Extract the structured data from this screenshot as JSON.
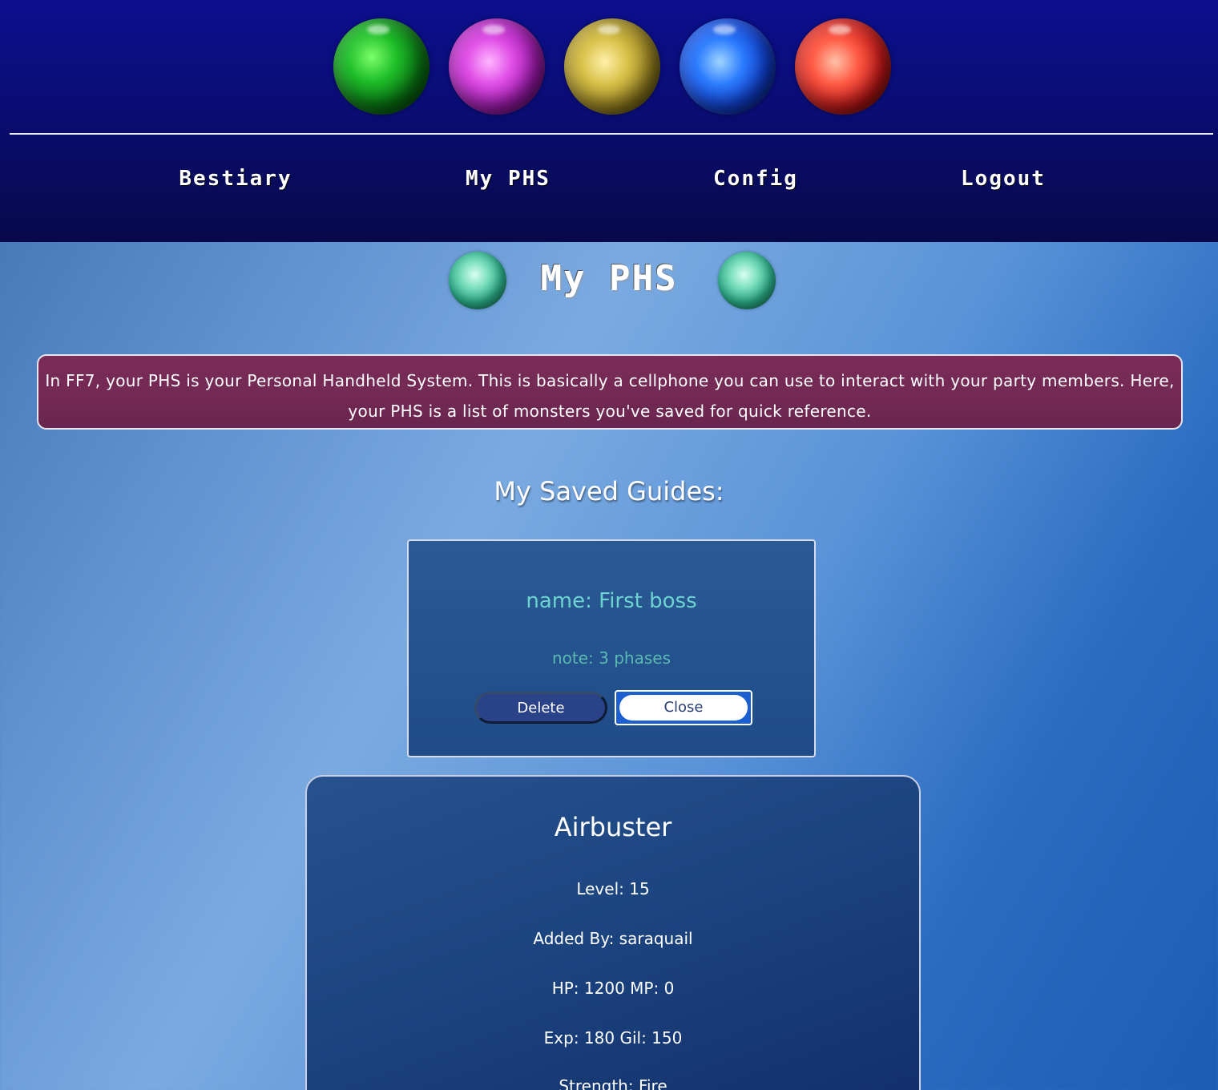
{
  "header": {
    "orbs": [
      "green-materia-icon",
      "purple-materia-icon",
      "yellow-materia-icon",
      "blue-materia-icon",
      "red-materia-icon"
    ],
    "nav": {
      "bestiary": "Bestiary",
      "my_phs": "My PHS",
      "config": "Config",
      "logout": "Logout"
    }
  },
  "page": {
    "title": "My PHS",
    "intro": "In FF7, your PHS is your Personal Handheld System. This is basically a cellphone you can use to interact with your party members. Here, your PHS is a list of monsters you've saved for quick reference.",
    "saved_heading": "My Saved Guides:"
  },
  "guide": {
    "name": "name: First boss",
    "note": "note: 3 phases",
    "delete_label": "Delete",
    "close_label": "Close"
  },
  "monster": {
    "name": "Airbuster",
    "level": "Level: 15",
    "added_by": "Added By: saraquail",
    "hp_mp": "HP: 1200 MP: 0",
    "exp_gil": "Exp: 180 Gil: 150",
    "strength": "Strength: Fire"
  },
  "colors": {
    "header_bg": "#0b0f8e",
    "intro_bg": "#7b2d58",
    "guide_name": "#6dd3d0",
    "card_bg": "#1f4c88"
  }
}
